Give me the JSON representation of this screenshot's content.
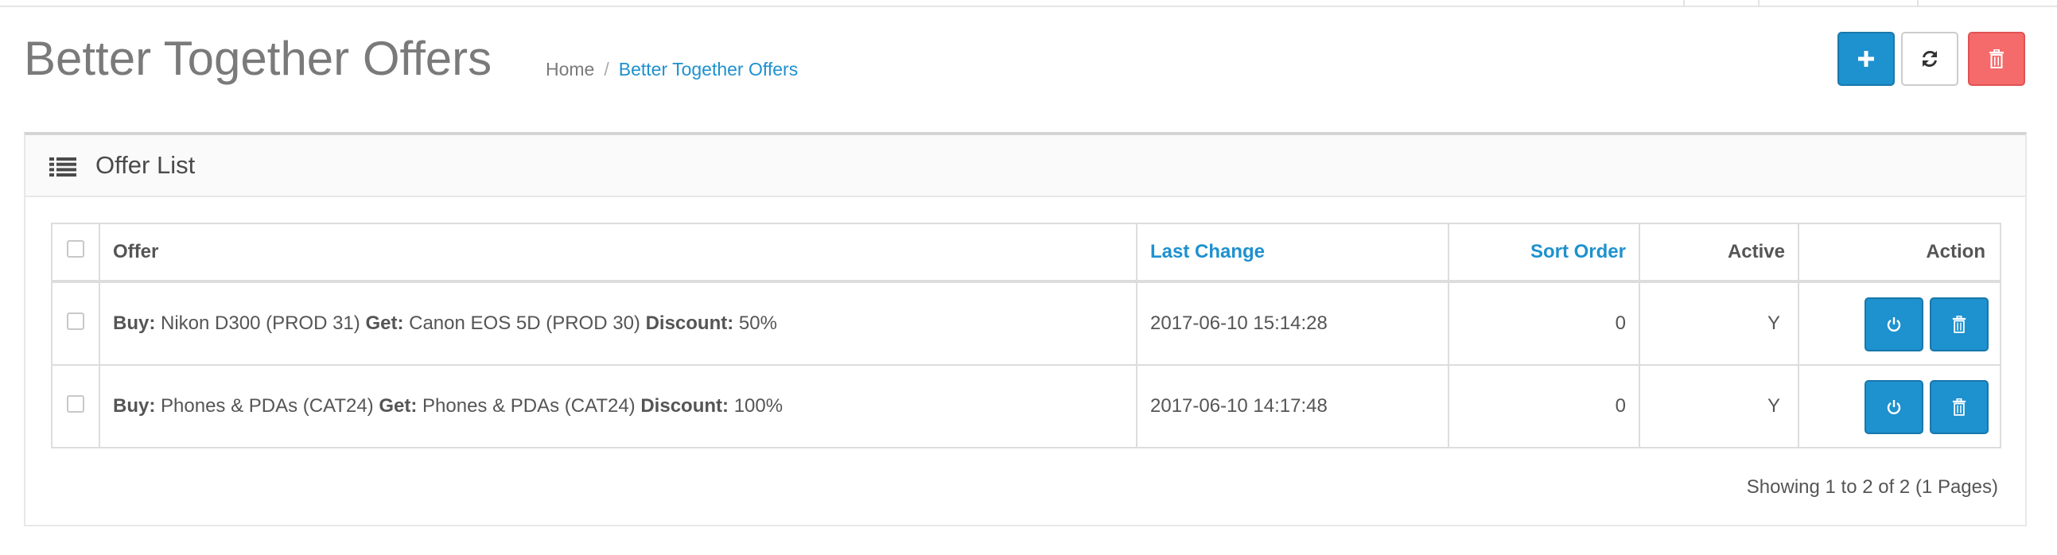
{
  "header": {
    "title": "Better Together Offers",
    "breadcrumb": {
      "home": "Home",
      "divider": "/",
      "current": "Better Together Offers"
    },
    "buttons": {
      "add_icon": "plus-icon",
      "refresh_icon": "refresh-icon",
      "delete_icon": "trash-icon"
    }
  },
  "panel": {
    "icon": "list-icon",
    "title": "Offer List"
  },
  "table": {
    "headers": {
      "offer": "Offer",
      "last_change": "Last Change",
      "sort_order": "Sort Order",
      "active": "Active",
      "action": "Action"
    },
    "rows": [
      {
        "buy_label": "Buy:",
        "buy_value": "Nikon D300 (PROD 31)",
        "get_label": "Get:",
        "get_value": "Canon EOS 5D (PROD 30)",
        "discount_label": "Discount:",
        "discount_value": "50%",
        "last_change": "2017-06-10 15:14:28",
        "sort_order": "0",
        "active": "Y"
      },
      {
        "buy_label": "Buy:",
        "buy_value": "Phones & PDAs (CAT24)",
        "get_label": "Get:",
        "get_value": "Phones & PDAs (CAT24)",
        "discount_label": "Discount:",
        "discount_value": "100%",
        "last_change": "2017-06-10 14:17:48",
        "sort_order": "0",
        "active": "Y"
      }
    ]
  },
  "pagination": {
    "info": "Showing 1 to 2 of 2 (1 Pages)"
  },
  "colors": {
    "primary": "#1e91cf",
    "danger": "#f56b6b",
    "text": "#555555",
    "title": "#7a7a7a"
  }
}
